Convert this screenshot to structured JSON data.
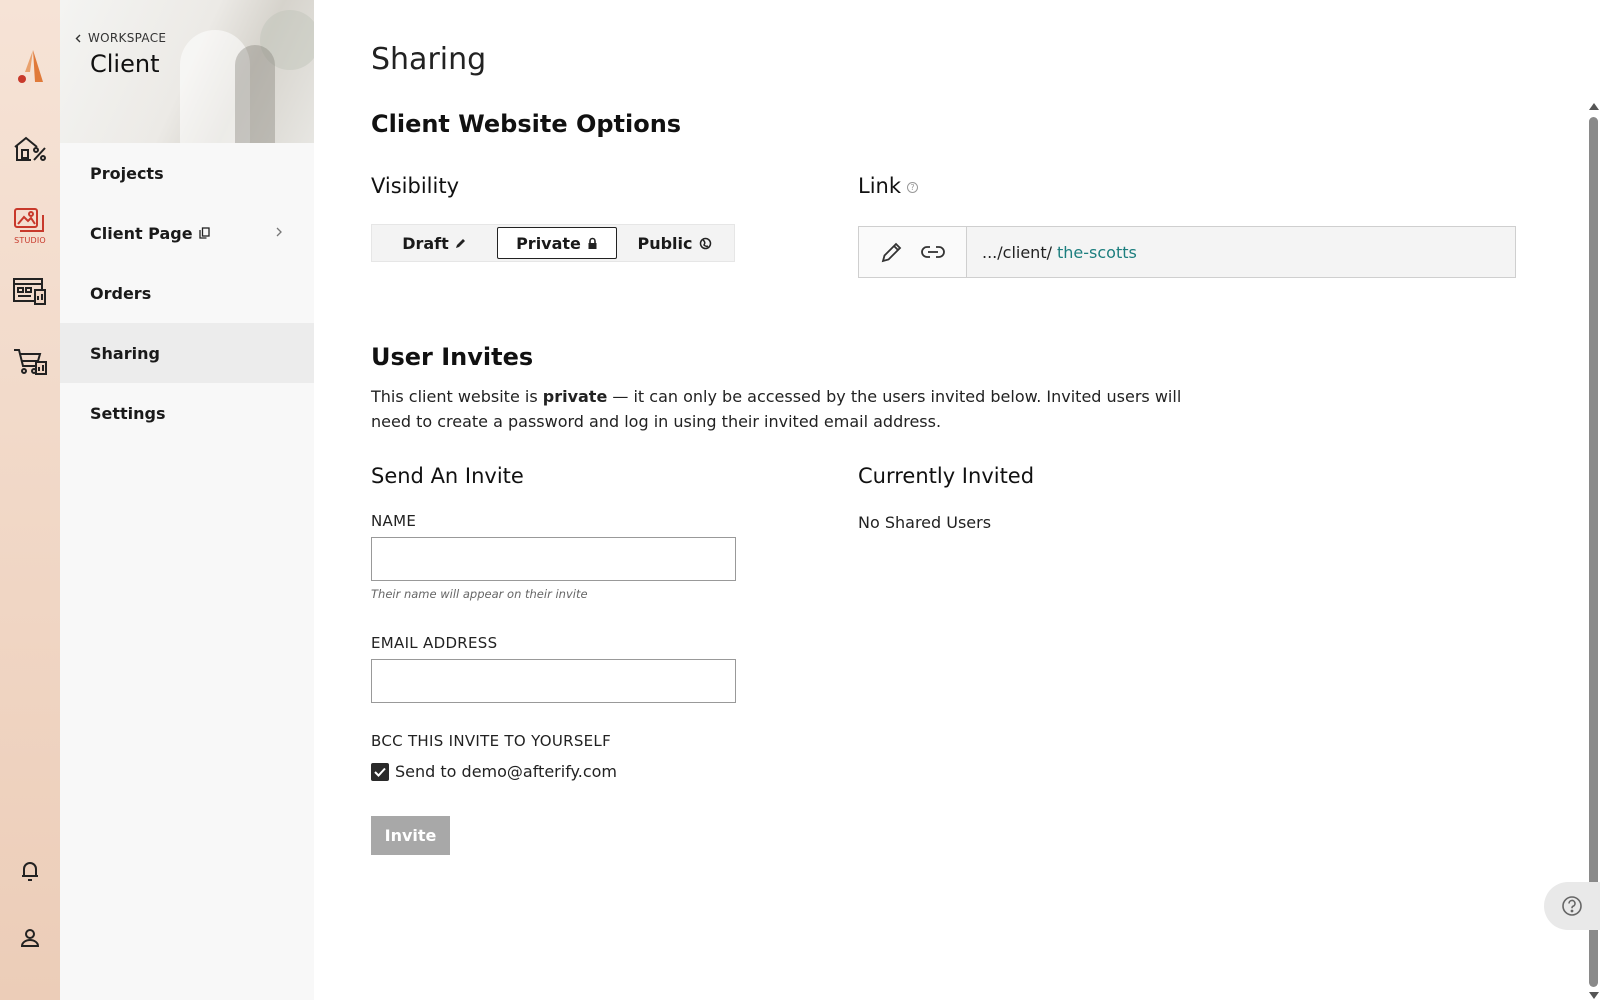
{
  "rail": {
    "studio_caption": "STUDIO",
    "icons": [
      "afterify-logo-icon",
      "home-percent-icon",
      "studio-gallery-icon",
      "dashboard-icon",
      "cart-chart-icon",
      "bell-icon",
      "user-icon"
    ],
    "brand_color": "#e07a3a",
    "active_color": "#c8392b"
  },
  "sidebar": {
    "back_label": "WORKSPACE",
    "title": "Client",
    "items": [
      {
        "label": "Projects"
      },
      {
        "label": "Client Page"
      },
      {
        "label": "Orders"
      },
      {
        "label": "Sharing"
      },
      {
        "label": "Settings"
      }
    ],
    "active_item": "Sharing"
  },
  "main": {
    "page_title": "Sharing",
    "options_heading": "Client Website Options",
    "visibility": {
      "heading": "Visibility",
      "options": [
        {
          "label": "Draft",
          "icon": "pencil-icon"
        },
        {
          "label": "Private",
          "icon": "lock-icon"
        },
        {
          "label": "Public",
          "icon": "globe-icon"
        }
      ],
      "selected": "Private"
    },
    "link": {
      "heading": "Link",
      "url_prefix": ".../client/",
      "slug": "the-scotts",
      "slug_color": "#1c7e7e"
    },
    "invites": {
      "heading": "User Invites",
      "desc_before": "This client website is ",
      "desc_bold": "private",
      "desc_after": " — it can only be accessed by the users invited below. Invited users will need to create a password and log in using their invited email address."
    },
    "send": {
      "heading": "Send An Invite",
      "name_label": "NAME",
      "name_value": "",
      "name_hint": "Their name will appear on their invite",
      "email_label": "EMAIL ADDRESS",
      "email_value": "",
      "bcc_label": "BCC THIS INVITE TO YOURSELF",
      "bcc_text": "Send to demo@afterify.com",
      "bcc_checked": true,
      "invite_button": "Invite"
    },
    "current": {
      "heading": "Currently Invited",
      "empty_text": "No Shared Users"
    }
  }
}
